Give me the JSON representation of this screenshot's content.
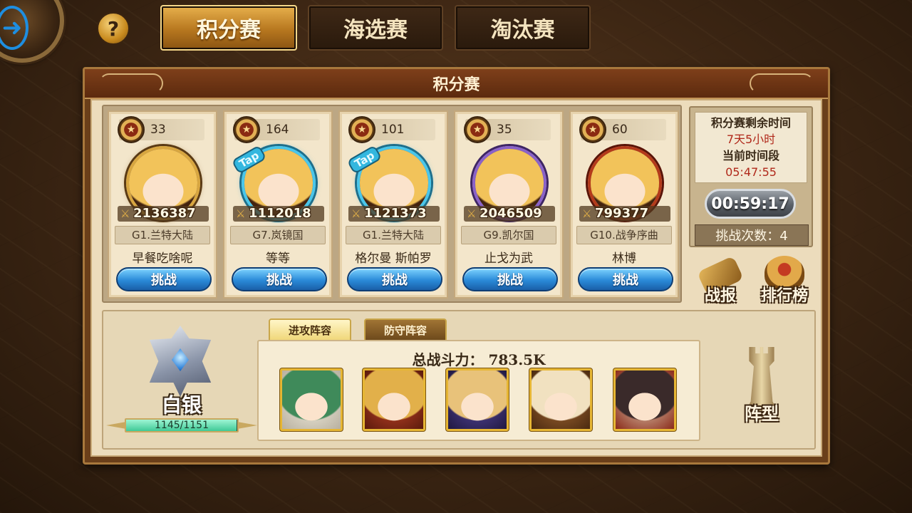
{
  "tabs": [
    {
      "label": "积分赛",
      "active": true
    },
    {
      "label": "海选赛",
      "active": false
    },
    {
      "label": "淘汰赛",
      "active": false
    }
  ],
  "help_label": "?",
  "panel_title": "积分赛",
  "opponents": [
    {
      "trophies": "33",
      "power": "2136387",
      "server": "G1.兰特大陆",
      "name": "早餐吃啥呢",
      "challenge": "挑战",
      "avatar_style": "gold",
      "tap": false
    },
    {
      "trophies": "164",
      "power": "1112018",
      "server": "G7.岚镜国",
      "name": "等等",
      "challenge": "挑战",
      "avatar_style": "tap",
      "tap": true
    },
    {
      "trophies": "101",
      "power": "1121373",
      "server": "G1.兰特大陆",
      "name": "格尔曼 斯帕罗",
      "challenge": "挑战",
      "avatar_style": "tap",
      "tap": true
    },
    {
      "trophies": "35",
      "power": "2046509",
      "server": "G9.凯尔国",
      "name": "止戈为武",
      "challenge": "挑战",
      "avatar_style": "purple",
      "tap": false
    },
    {
      "trophies": "60",
      "power": "799377",
      "server": "G10.战争序曲",
      "name": "林博",
      "challenge": "挑战",
      "avatar_style": "red",
      "tap": false
    }
  ],
  "tap_label": "Tap",
  "info": {
    "remaining_label": "积分赛剩余时间",
    "remaining_value": "7天5小时",
    "period_label": "当前时间段",
    "period_value": "05:47:55",
    "countdown": "00:59:17",
    "attempts": "挑战次数：4"
  },
  "side_buttons": {
    "battle_report": "战报",
    "leaderboard": "排行榜"
  },
  "rank": {
    "name": "白银",
    "progress_text": "1145/1151",
    "progress_fraction": 0.995
  },
  "team_tabs": {
    "attack": "进攻阵容",
    "defense": "防守阵容"
  },
  "total_power_label": "总战斗力：",
  "total_power_value": "783.5K",
  "heroes": [
    {
      "name": "green-hair-hero",
      "hair": "#3f8a5a",
      "bg1": "#f4f0e0",
      "bg2": "#b8b0a0"
    },
    {
      "name": "goggles-hero",
      "hair": "#e2b04a",
      "bg1": "#c8462a",
      "bg2": "#5a1a0c"
    },
    {
      "name": "witch-hero",
      "hair": "#e8c27a",
      "bg1": "#5a4aa2",
      "bg2": "#201840"
    },
    {
      "name": "aviator-hero",
      "hair": "#f1e1c0",
      "bg1": "#a86a34",
      "bg2": "#4a2a10"
    },
    {
      "name": "dark-hair-hero",
      "hair": "#3a2a2a",
      "bg1": "#e2d2b6",
      "bg2": "#8a2a1a"
    }
  ],
  "formation_label": "阵型",
  "colors": {
    "accent_gold": "#e7b04c",
    "challenge_blue": "#2a8ad8",
    "timer_red": "#b0281a"
  }
}
